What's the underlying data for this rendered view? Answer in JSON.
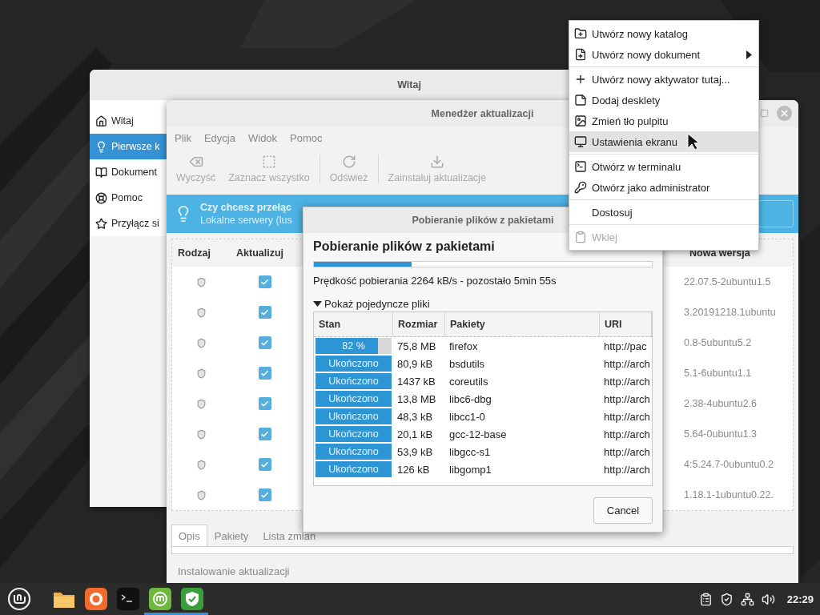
{
  "welcome_window": {
    "title": "Witaj",
    "sidebar": [
      {
        "label": "Witaj",
        "selected": false
      },
      {
        "label": "Pierwsze k",
        "selected": true
      },
      {
        "label": "Dokument",
        "selected": false
      },
      {
        "label": "Pomoc",
        "selected": false
      },
      {
        "label": "Przyłącz si",
        "selected": false
      }
    ]
  },
  "update_manager": {
    "title": "Menedżer aktualizacji",
    "menu": [
      "Plik",
      "Edycja",
      "Widok",
      "Pomoc"
    ],
    "toolbar": [
      {
        "label": "Wyczyść",
        "disabled": true,
        "separator_before": false
      },
      {
        "label": "Zaznacz wszystko",
        "disabled": true,
        "separator_before": false
      },
      {
        "label": "Odśwież",
        "disabled": true,
        "separator_before": true
      },
      {
        "label": "Zainstaluj aktualizacje",
        "disabled": true,
        "separator_before": true
      }
    ],
    "infobar": {
      "title": "Czy chcesz przełąc",
      "text": "Lokalne serwery (lus"
    },
    "table": {
      "columns": [
        "Rodzaj",
        "Aktualizuj",
        "Nowa wersja"
      ],
      "rows": [
        {
          "checked": true,
          "new_version": "22.07.5-2ubuntu1.5"
        },
        {
          "checked": true,
          "new_version": "3.20191218.1ubuntu"
        },
        {
          "checked": true,
          "new_version": "0.8-5ubuntu5.2"
        },
        {
          "checked": true,
          "new_version": "5.1-6ubuntu1.1"
        },
        {
          "checked": true,
          "new_version": "2.38-4ubuntu2.6"
        },
        {
          "checked": true,
          "new_version": "5.64-0ubuntu1.3"
        },
        {
          "checked": true,
          "new_version": "4:5.24.7-0ubuntu0.2"
        },
        {
          "checked": true,
          "new_version": "1.18.1-1ubuntu0.22."
        }
      ]
    },
    "tabs": [
      {
        "label": "Opis",
        "selected": true
      },
      {
        "label": "Pakiety",
        "selected": false
      },
      {
        "label": "Lista zmian",
        "selected": false
      }
    ],
    "status": "Instalowanie aktualizacji"
  },
  "download_dialog": {
    "title": "Pobieranie plików z pakietami",
    "heading": "Pobieranie plików z pakietami",
    "progress": {
      "level": 0.29
    },
    "speed_text": "Prędkość pobierania 2264 kB/s - pozostało 5min 55s",
    "expander": {
      "label": "Pokaż pojedyncze pliki",
      "expanded": true
    },
    "table": {
      "columns": [
        "Stan",
        "Rozmiar",
        "Pakiety",
        "URI"
      ],
      "rows": [
        {
          "status": "82 %",
          "level": 0.82,
          "size": "75,8 MB",
          "package": "firefox",
          "uri": "http://pac"
        },
        {
          "status": "Ukończono",
          "level": 1,
          "size": "80,9 kB",
          "package": "bsdutils",
          "uri": "http://arch"
        },
        {
          "status": "Ukończono",
          "level": 1,
          "size": "1437 kB",
          "package": "coreutils",
          "uri": "http://arch"
        },
        {
          "status": "Ukończono",
          "level": 1,
          "size": "13,8 MB",
          "package": "libc6-dbg",
          "uri": "http://arch"
        },
        {
          "status": "Ukończono",
          "level": 1,
          "size": "48,3 kB",
          "package": "libcc1-0",
          "uri": "http://arch"
        },
        {
          "status": "Ukończono",
          "level": 1,
          "size": "20,1 kB",
          "package": "gcc-12-base",
          "uri": "http://arch"
        },
        {
          "status": "Ukończono",
          "level": 1,
          "size": "53,9 kB",
          "package": "libgcc-s1",
          "uri": "http://arch"
        },
        {
          "status": "Ukończono",
          "level": 1,
          "size": "126 kB",
          "package": "libgomp1",
          "uri": "http://arch"
        }
      ]
    },
    "cancel_button": "Cancel"
  },
  "context_menu": {
    "items": [
      {
        "label": "Utwórz nowy katalog",
        "selected": false,
        "disabled": false,
        "submenu": false,
        "separator_after": false
      },
      {
        "label": "Utwórz nowy dokument",
        "selected": false,
        "disabled": false,
        "submenu": true,
        "separator_after": true
      },
      {
        "label": "Utwórz nowy aktywator tutaj...",
        "selected": false,
        "disabled": false,
        "submenu": false,
        "separator_after": false
      },
      {
        "label": "Dodaj desklety",
        "selected": false,
        "disabled": false,
        "submenu": false,
        "separator_after": false
      },
      {
        "label": "Zmień tło pulpitu",
        "selected": false,
        "disabled": false,
        "submenu": false,
        "separator_after": false
      },
      {
        "label": "Ustawienia ekranu",
        "selected": true,
        "disabled": false,
        "submenu": false,
        "separator_after": true
      },
      {
        "label": "Otwórz w terminalu",
        "selected": false,
        "disabled": false,
        "submenu": false,
        "separator_after": false
      },
      {
        "label": "Otwórz jako administrator",
        "selected": false,
        "disabled": false,
        "submenu": false,
        "separator_after": true
      },
      {
        "label": "Dostosuj",
        "selected": false,
        "disabled": false,
        "submenu": false,
        "separator_after": true
      },
      {
        "label": "Wklej",
        "selected": false,
        "disabled": true,
        "submenu": false,
        "separator_after": false
      }
    ]
  },
  "taskbar": {
    "launchers": [
      {
        "active": false
      },
      {
        "active": false
      },
      {
        "active": false
      },
      {
        "active": true
      },
      {
        "active": true
      }
    ],
    "clock": "22:29"
  }
}
